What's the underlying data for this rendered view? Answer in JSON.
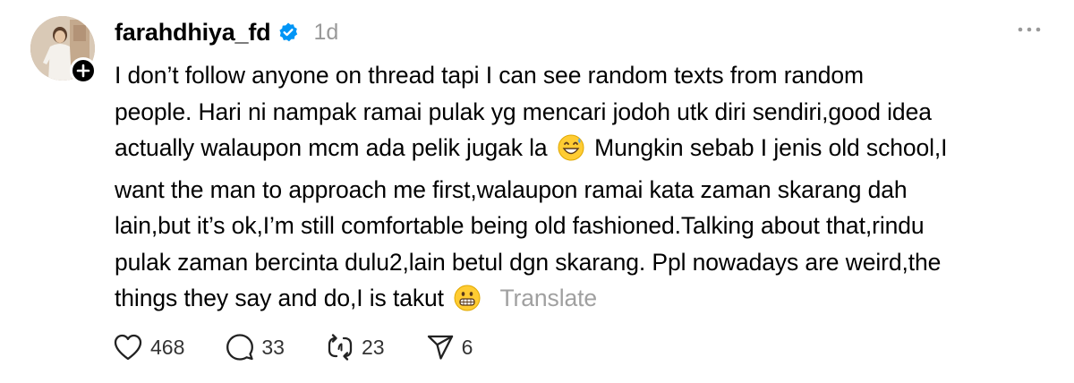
{
  "author": {
    "username": "farahdhiya_fd",
    "verified": true,
    "timestamp": "1d"
  },
  "post": {
    "text_lines": [
      "I don’t follow anyone on thread tapi I can see random texts from random",
      "people. Hari ni nampak ramai pulak yg mencari jodoh utk diri sendiri,good idea",
      "actually walaupon mcm ada pelik jugak la",
      "Mungkin sebab I jenis old school,I",
      "want the man to approach me first,walaupon ramai kata zaman skarang dah",
      "lain,but it’s ok,I’m still comfortable being old fashioned.Talking about that,rindu",
      "pulak zaman bercinta dulu2,lain betul dgn skarang. Ppl nowadays are weird,the",
      "things they say and do,I is takut"
    ],
    "translate_label": "Translate"
  },
  "actions": {
    "likes": "468",
    "replies": "33",
    "reposts": "23",
    "shares": "6"
  },
  "icons": {
    "more": "more-horizontal-icon",
    "verified": "verified-badge-icon",
    "follow": "plus-icon",
    "like": "heart-icon",
    "reply": "comment-bubble-icon",
    "repost": "repost-arrows-icon",
    "share": "send-icon",
    "emoji_1": "grinning-face-with-sweat-emoji",
    "emoji_2": "grimacing-face-emoji"
  },
  "colors": {
    "verified_blue": "#0095F6",
    "muted_gray": "#999999",
    "text": "#000000"
  }
}
